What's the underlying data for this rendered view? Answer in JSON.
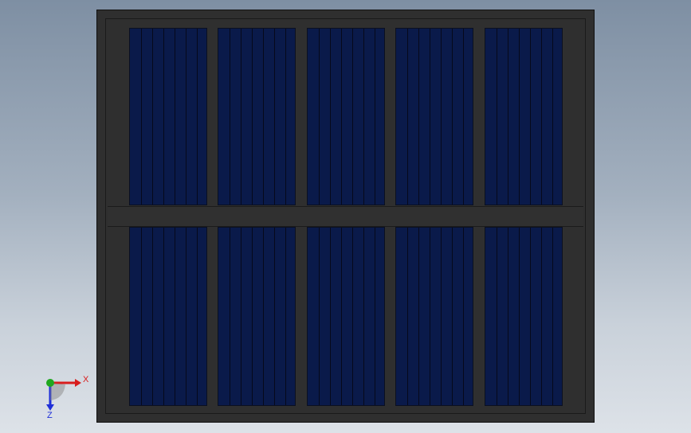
{
  "viewport": {
    "background_top": "#7e8fa3",
    "background_bottom": "#dde2e8"
  },
  "model": {
    "frame_color": "#2f2f2f",
    "cell_color": "#0a1a4a",
    "strip_color": "#06091a",
    "rows": 2,
    "columns": 5,
    "strips_per_cell": 7
  },
  "triad": {
    "x_label": "X",
    "z_label": "Z",
    "x_color": "#d81d1d",
    "y_color": "#1fa81f",
    "z_color": "#1f2fd8"
  }
}
